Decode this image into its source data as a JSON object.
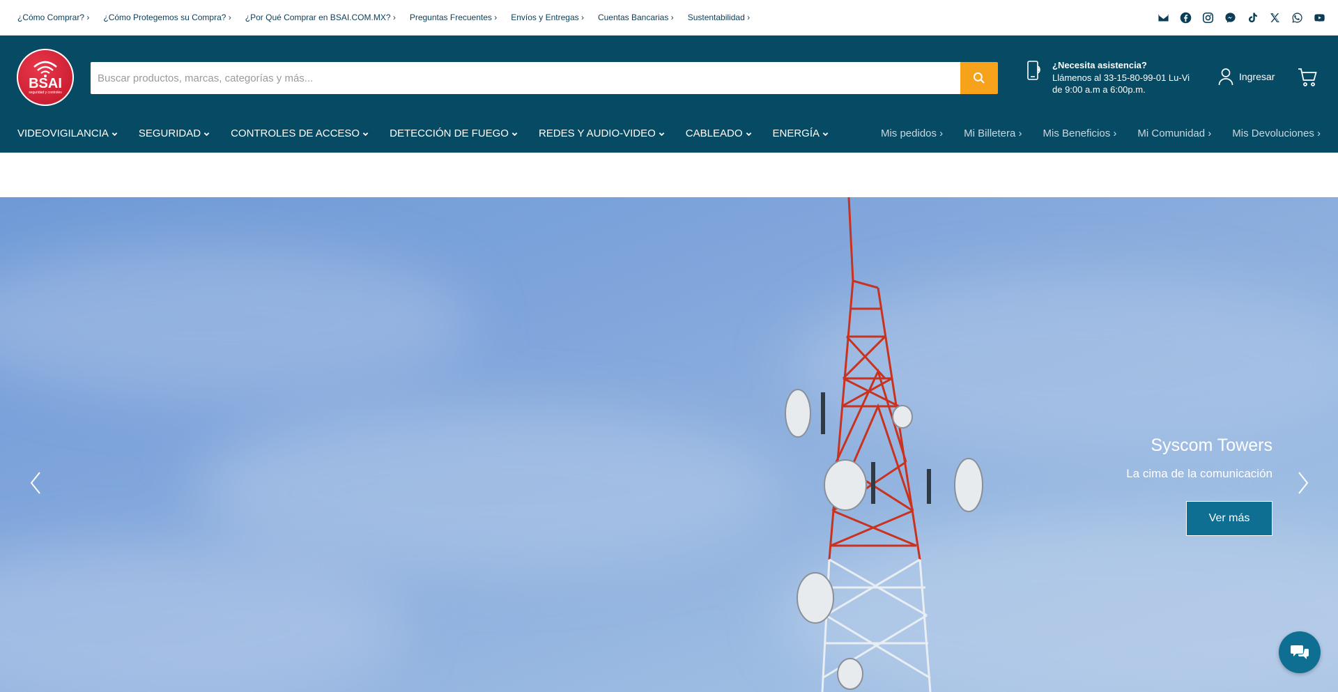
{
  "top_links": [
    "¿Cómo Comprar? ›",
    "¿Cómo Protegemos su Compra? ›",
    "¿Por Qué Comprar en BSAI.COM.MX? ›",
    "Preguntas Frecuentes ›",
    "Envíos y Entregas ›",
    "Cuentas Bancarias ›",
    "Sustentabilidad ›"
  ],
  "social_icons": [
    "email-icon",
    "facebook-icon",
    "instagram-icon",
    "messenger-icon",
    "tiktok-icon",
    "x-icon",
    "whatsapp-icon",
    "youtube-icon"
  ],
  "brand": {
    "name": "BSAI",
    "tagline": "seguridad y controles",
    "colors": {
      "primary": "#074a63",
      "accent": "#f6a21b",
      "logo": "#d01f33",
      "button": "#0e6f93"
    }
  },
  "search": {
    "placeholder": "Buscar productos, marcas, categorías y más..."
  },
  "assistance": {
    "title": "¿Necesita asistencia?",
    "text": "Llámenos al 33-15-80-99-01 Lu-Vi de 9:00 a.m a 6:00p.m."
  },
  "account": {
    "login_label": "Ingresar"
  },
  "nav": [
    "VIDEOVIGILANCIA",
    "SEGURIDAD",
    "CONTROLES DE ACCESO",
    "DETECCIÓN DE FUEGO",
    "REDES Y AUDIO-VIDEO",
    "CABLEADO",
    "ENERGÍA"
  ],
  "subnav": [
    "Mis pedidos ›",
    "Mi Billetera ›",
    "Mis Beneficios ›",
    "Mi Comunidad ›",
    "Mis Devoluciones ›"
  ],
  "hero": {
    "title": "Syscom Towers",
    "subtitle": "La cima de la comunicación",
    "cta": "Ver más"
  }
}
